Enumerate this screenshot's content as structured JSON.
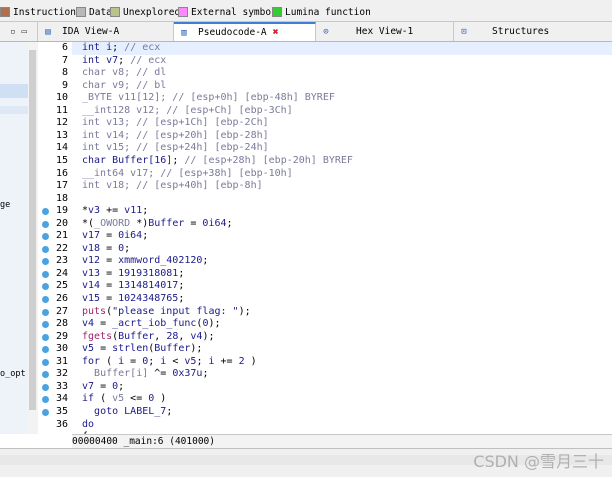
{
  "legend": [
    {
      "label": "Instruction",
      "color": "#b07050"
    },
    {
      "label": "Data",
      "color": "#b8b8b8"
    },
    {
      "label": "Unexplored",
      "color": "#b8c48c"
    },
    {
      "label": "External symbol",
      "color": "#ff88ff"
    },
    {
      "label": "Lumina function",
      "color": "#33cc33"
    }
  ],
  "tabs": [
    {
      "label": "IDA View-A",
      "icon": "ida-view-icon",
      "close": ""
    },
    {
      "label": "Pseudocode-A",
      "icon": "pseudocode-icon",
      "close": "✖"
    },
    {
      "label": "Hex View-1",
      "icon": "hex-view-icon",
      "close": ""
    },
    {
      "label": "Structures",
      "icon": "structures-icon",
      "close": ""
    }
  ],
  "left_pane": {
    "items": [
      "ge",
      "o_opt"
    ]
  },
  "code_lines": [
    {
      "n": "6",
      "dot": false,
      "parts": [
        [
          "kw",
          "int "
        ],
        [
          "var",
          "i"
        ],
        [
          "",
          "; "
        ],
        [
          "cmt",
          "// ecx"
        ]
      ]
    },
    {
      "n": "7",
      "dot": false,
      "parts": [
        [
          "kw",
          "int "
        ],
        [
          "var",
          "v7"
        ],
        [
          "",
          "; "
        ],
        [
          "cmt",
          "// ecx"
        ]
      ]
    },
    {
      "n": "8",
      "dot": false,
      "parts": [
        [
          "cmt",
          "char v8; // dl"
        ]
      ]
    },
    {
      "n": "9",
      "dot": false,
      "parts": [
        [
          "cmt",
          "char v9; // bl"
        ]
      ]
    },
    {
      "n": "10",
      "dot": false,
      "parts": [
        [
          "cmt",
          "_BYTE v11[12]; // [esp+0h] [ebp-48h] BYREF"
        ]
      ]
    },
    {
      "n": "11",
      "dot": false,
      "parts": [
        [
          "cmt",
          "__int128 v12; // [esp+Ch] [ebp-3Ch]"
        ]
      ]
    },
    {
      "n": "12",
      "dot": false,
      "parts": [
        [
          "cmt",
          "int v13; // [esp+1Ch] [ebp-2Ch]"
        ]
      ]
    },
    {
      "n": "13",
      "dot": false,
      "parts": [
        [
          "cmt",
          "int v14; // [esp+20h] [ebp-28h]"
        ]
      ]
    },
    {
      "n": "14",
      "dot": false,
      "parts": [
        [
          "cmt",
          "int v15; // [esp+24h] [ebp-24h]"
        ]
      ]
    },
    {
      "n": "15",
      "dot": false,
      "parts": [
        [
          "kw",
          "char "
        ],
        [
          "var",
          "Buffer[16]"
        ],
        [
          "",
          "; "
        ],
        [
          "cmt",
          "// [esp+28h] [ebp-20h] BYREF"
        ]
      ]
    },
    {
      "n": "16",
      "dot": false,
      "parts": [
        [
          "cmt",
          "__int64 v17; // [esp+38h] [ebp-10h]"
        ]
      ]
    },
    {
      "n": "17",
      "dot": false,
      "parts": [
        [
          "cmt",
          "int v18; // [esp+40h] [ebp-8h]"
        ]
      ]
    },
    {
      "n": "18",
      "dot": false,
      "parts": [
        [
          "",
          ""
        ]
      ]
    },
    {
      "n": "19",
      "dot": true,
      "parts": [
        [
          "",
          "*"
        ],
        [
          "var",
          "v3"
        ],
        [
          "",
          " += "
        ],
        [
          "var",
          "v11"
        ],
        [
          "",
          ";"
        ]
      ]
    },
    {
      "n": "20",
      "dot": true,
      "parts": [
        [
          "",
          "*("
        ],
        [
          "cmt",
          "_OWORD"
        ],
        [
          "",
          " *)"
        ],
        [
          "var",
          "Buffer"
        ],
        [
          "",
          " = "
        ],
        [
          "num",
          "0i64"
        ],
        [
          "",
          ";"
        ]
      ]
    },
    {
      "n": "21",
      "dot": true,
      "parts": [
        [
          "var",
          "v17"
        ],
        [
          "",
          " = "
        ],
        [
          "num",
          "0i64"
        ],
        [
          "",
          ";"
        ]
      ]
    },
    {
      "n": "22",
      "dot": true,
      "parts": [
        [
          "var",
          "v18"
        ],
        [
          "",
          " = "
        ],
        [
          "num",
          "0"
        ],
        [
          "",
          ";"
        ]
      ]
    },
    {
      "n": "23",
      "dot": true,
      "parts": [
        [
          "var",
          "v12"
        ],
        [
          "",
          " = "
        ],
        [
          "var",
          "xmmword_402120"
        ],
        [
          "",
          ";"
        ]
      ]
    },
    {
      "n": "24",
      "dot": true,
      "parts": [
        [
          "var",
          "v13"
        ],
        [
          "",
          " = "
        ],
        [
          "num",
          "1919318081"
        ],
        [
          "",
          ";"
        ]
      ]
    },
    {
      "n": "25",
      "dot": true,
      "parts": [
        [
          "var",
          "v14"
        ],
        [
          "",
          " = "
        ],
        [
          "num",
          "1314814017"
        ],
        [
          "",
          ";"
        ]
      ]
    },
    {
      "n": "26",
      "dot": true,
      "parts": [
        [
          "var",
          "v15"
        ],
        [
          "",
          " = "
        ],
        [
          "num",
          "1024348765"
        ],
        [
          "",
          ";"
        ]
      ]
    },
    {
      "n": "27",
      "dot": true,
      "parts": [
        [
          "fn",
          "puts"
        ],
        [
          "",
          "("
        ],
        [
          "str",
          "\"please input flag: \""
        ],
        [
          "",
          ");"
        ]
      ]
    },
    {
      "n": "28",
      "dot": true,
      "parts": [
        [
          "var",
          "v4"
        ],
        [
          "",
          " = "
        ],
        [
          "var",
          "_acrt_iob_func"
        ],
        [
          "",
          "("
        ],
        [
          "num",
          "0"
        ],
        [
          "",
          ");"
        ]
      ]
    },
    {
      "n": "29",
      "dot": true,
      "parts": [
        [
          "fn",
          "fgets"
        ],
        [
          "",
          "("
        ],
        [
          "var",
          "Buffer"
        ],
        [
          "",
          ", "
        ],
        [
          "num",
          "28"
        ],
        [
          "",
          ", "
        ],
        [
          "var",
          "v4"
        ],
        [
          "",
          ");"
        ]
      ]
    },
    {
      "n": "30",
      "dot": true,
      "parts": [
        [
          "var",
          "v5"
        ],
        [
          "",
          " = "
        ],
        [
          "var",
          "strlen"
        ],
        [
          "",
          "("
        ],
        [
          "var",
          "Buffer"
        ],
        [
          "",
          ");"
        ]
      ]
    },
    {
      "n": "31",
      "dot": true,
      "parts": [
        [
          "kw",
          "for"
        ],
        [
          "",
          " ( "
        ],
        [
          "var",
          "i"
        ],
        [
          "",
          " = "
        ],
        [
          "num",
          "0"
        ],
        [
          "",
          "; "
        ],
        [
          "var",
          "i"
        ],
        [
          "",
          " < "
        ],
        [
          "var",
          "v5"
        ],
        [
          "",
          "; "
        ],
        [
          "var",
          "i"
        ],
        [
          "",
          " += "
        ],
        [
          "num",
          "2"
        ],
        [
          "",
          " )"
        ]
      ]
    },
    {
      "n": "32",
      "dot": true,
      "parts": [
        [
          "",
          "  "
        ],
        [
          "cmt",
          "Buffer[i]"
        ],
        [
          "",
          " ^= "
        ],
        [
          "num",
          "0x37u"
        ],
        [
          "",
          ";"
        ]
      ]
    },
    {
      "n": "33",
      "dot": true,
      "parts": [
        [
          "var",
          "v7"
        ],
        [
          "",
          " = "
        ],
        [
          "num",
          "0"
        ],
        [
          "",
          ";"
        ]
      ]
    },
    {
      "n": "34",
      "dot": true,
      "parts": [
        [
          "kw",
          "if"
        ],
        [
          "",
          " ( "
        ],
        [
          "cmt",
          "v5"
        ],
        [
          "",
          " <= "
        ],
        [
          "num",
          "0"
        ],
        [
          "",
          " )"
        ]
      ]
    },
    {
      "n": "35",
      "dot": true,
      "parts": [
        [
          "",
          "  "
        ],
        [
          "kw",
          "goto "
        ],
        [
          "var",
          "LABEL_7"
        ],
        [
          "",
          ";"
        ]
      ]
    },
    {
      "n": "36",
      "dot": false,
      "parts": [
        [
          "kw",
          "do"
        ]
      ]
    },
    {
      "n": "",
      "dot": false,
      "parts": [
        [
          "",
          "{"
        ]
      ]
    }
  ],
  "status_text": "00000400 _main:6 (401000)",
  "watermark": "CSDN @雪月三十"
}
